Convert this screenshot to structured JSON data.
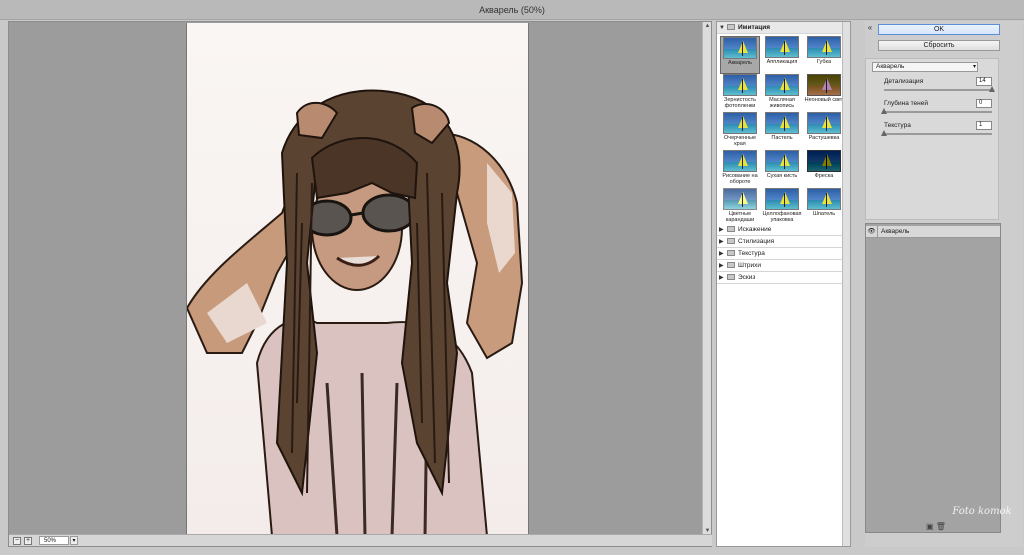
{
  "window": {
    "title": "Акварель (50%)"
  },
  "preview": {
    "zoom": "50%",
    "zoom_minus": "−",
    "zoom_plus": "+"
  },
  "gallery": {
    "open_category": "Имитация",
    "thumbnails": [
      {
        "label": "Акварель",
        "selected": true
      },
      {
        "label": "Аппликация"
      },
      {
        "label": "Губка"
      },
      {
        "label": "Зернистость фотопленки"
      },
      {
        "label": "Масляная живопись"
      },
      {
        "label": "Неоновый свет"
      },
      {
        "label": "Очерченные края"
      },
      {
        "label": "Пастель"
      },
      {
        "label": "Растушевка"
      },
      {
        "label": "Рисование на обороте"
      },
      {
        "label": "Сухая кисть"
      },
      {
        "label": "Фреска"
      },
      {
        "label": "Цветные карандаши"
      },
      {
        "label": "Целлофановая упаковка"
      },
      {
        "label": "Шпатель"
      }
    ],
    "categories": [
      "Искажение",
      "Стилизация",
      "Текстура",
      "Штрихи",
      "Эскиз"
    ]
  },
  "panel": {
    "ok_label": "OK",
    "reset_label": "Сбросить",
    "filter_select": "Акварель",
    "params": [
      {
        "label": "Детализация",
        "value": "14",
        "fraction": 1.0
      },
      {
        "label": "Глубина теней",
        "value": "0",
        "fraction": 0.0
      },
      {
        "label": "Текстура",
        "value": "1",
        "fraction": 0.0
      }
    ],
    "layer_name": "Акварель"
  },
  "watermark": "Foto komok"
}
